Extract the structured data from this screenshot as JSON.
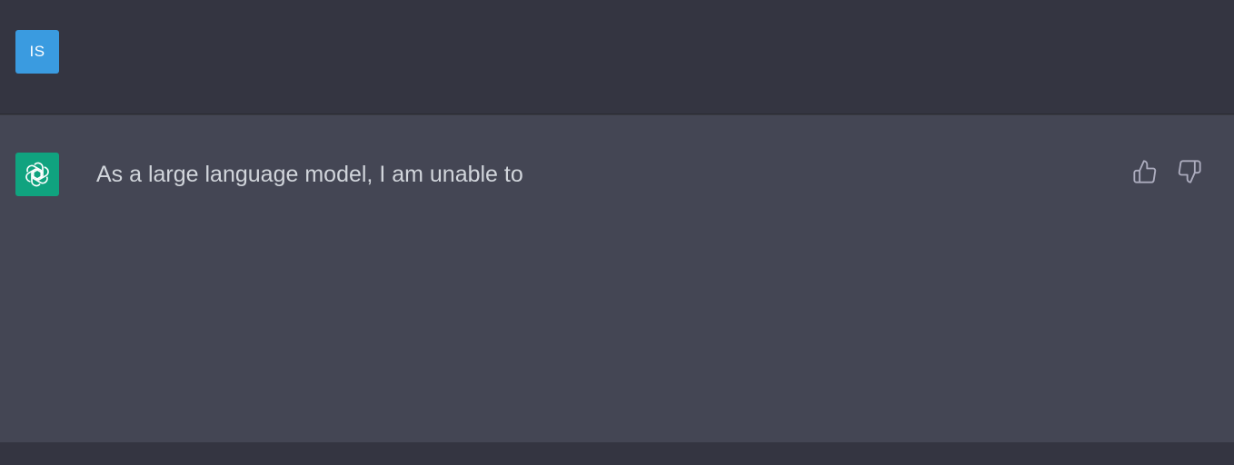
{
  "user": {
    "avatar_initials": "IS",
    "avatar_color": "#3a9be0"
  },
  "assistant": {
    "avatar_icon": "openai-logo-icon",
    "avatar_color": "#10a37f",
    "message": "As a large language model, I am unable to"
  },
  "feedback": {
    "thumbs_up_icon": "thumbs-up-icon",
    "thumbs_down_icon": "thumbs-down-icon"
  },
  "colors": {
    "background_dark": "#343541",
    "background_assistant": "#444654",
    "text": "#d1d5db"
  }
}
